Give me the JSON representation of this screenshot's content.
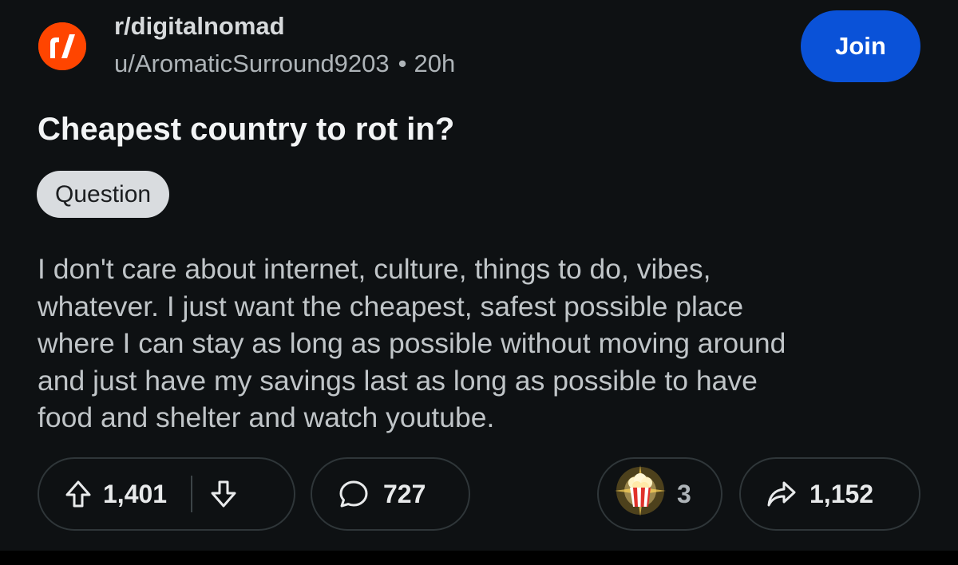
{
  "header": {
    "subreddit": "r/digitalnomad",
    "author": "u/AromaticSurround9203",
    "separator": "•",
    "time": "20h",
    "join_label": "Join",
    "avatar_icon": "subreddit-logo-icon"
  },
  "post": {
    "title": "Cheapest country to rot in?",
    "flair": "Question",
    "body_lines": [
      "I don't care about internet, culture, things to do, vibes,",
      "whatever. I just want the cheapest, safest possible place",
      "where I can stay as long as possible without moving around",
      "and just have my savings last as long as possible to have",
      "food and shelter and watch youtube."
    ]
  },
  "actions": {
    "upvotes": "1,401",
    "comments": "727",
    "awards": "3",
    "shares": "1,152"
  },
  "colors": {
    "background": "#0e1113",
    "accent_join": "#0a52d8",
    "avatar": "#ff4500",
    "flair_bg": "#d9dcdf"
  }
}
